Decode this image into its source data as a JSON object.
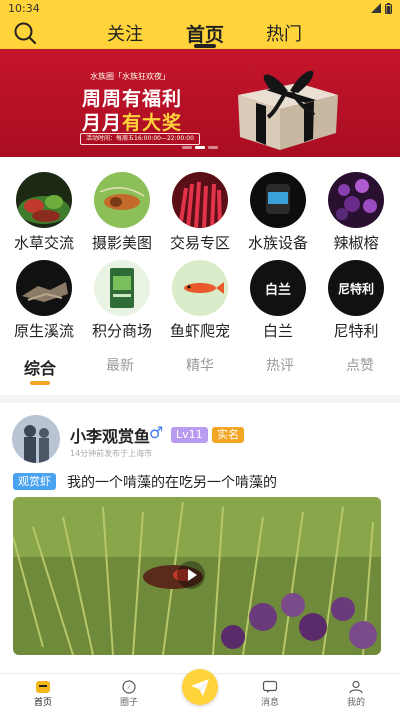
{
  "status_bar": {
    "time": "10:34"
  },
  "header": {
    "tabs": [
      {
        "label": "关注"
      },
      {
        "label": "首页"
      },
      {
        "label": "热门"
      }
    ],
    "active_tab": "首页"
  },
  "banner": {
    "subtitle": "水族圈「水族狂欢夜」",
    "title_line1": "周周有福利",
    "title_line2_a": "月月",
    "title_line2_b": "有大奖",
    "time_text": "活动时间：每周五16:00:00—22:00:00"
  },
  "categories": [
    {
      "label": "水草交流",
      "icon": "aquatic-plants-icon"
    },
    {
      "label": "摄影美图",
      "icon": "photography-icon"
    },
    {
      "label": "交易专区",
      "icon": "trading-icon"
    },
    {
      "label": "水族设备",
      "icon": "equipment-icon"
    },
    {
      "label": "辣椒榕",
      "icon": "bucephalandra-icon"
    },
    {
      "label": "原生溪流",
      "icon": "native-stream-icon"
    },
    {
      "label": "积分商场",
      "icon": "points-mall-icon"
    },
    {
      "label": "鱼虾爬宠",
      "icon": "fish-shrimp-icon"
    },
    {
      "label": "白兰",
      "icon": "bailan-brand-icon",
      "brand": "白兰"
    },
    {
      "label": "尼特利",
      "icon": "nitelie-brand-icon",
      "brand": "尼特利"
    }
  ],
  "feed_tabs": [
    {
      "label": "综合"
    },
    {
      "label": "最新"
    },
    {
      "label": "精华"
    },
    {
      "label": "热评"
    },
    {
      "label": "点赞"
    }
  ],
  "post": {
    "username": "小李观赏鱼",
    "gender_symbol": "♂",
    "level": "Lv11",
    "verified": "实名",
    "meta": "14分钟前发布于上海市",
    "tag": "观赏虾",
    "title": "我的一个啃藻的在吃另一个啃藻的"
  },
  "bottom_nav": {
    "items": [
      {
        "label": "首页"
      },
      {
        "label": "圈子"
      },
      {
        "label": "消息"
      },
      {
        "label": "我的"
      }
    ]
  },
  "colors": {
    "accent": "#ffd43a",
    "feed_underline": "#f5a623",
    "level_badge": "#b99cf0",
    "verify_badge": "#f3a524",
    "tag": "#4aa3f0",
    "banner_red": "#c5152b"
  }
}
